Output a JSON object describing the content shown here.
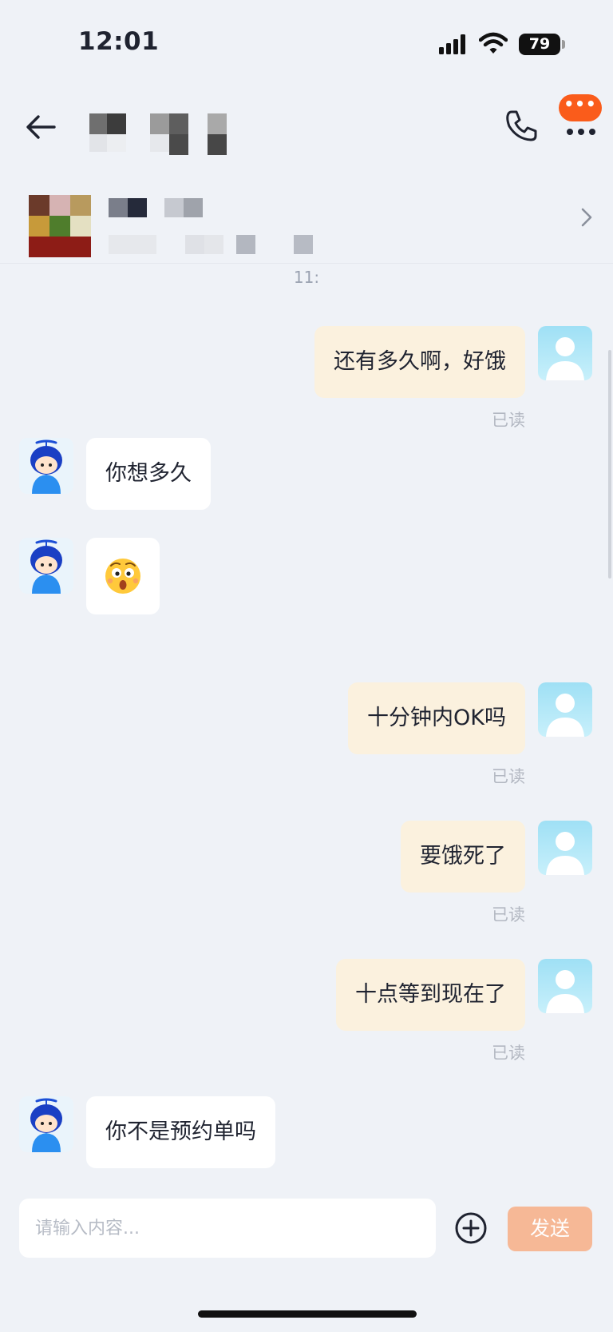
{
  "status_bar": {
    "time": "12:01",
    "battery_level": "79"
  },
  "header": {
    "back_icon": "arrow-left-icon",
    "phone_icon": "phone-icon",
    "more_icon": "more-dots-icon",
    "more_badge": "•••"
  },
  "order_card": {
    "chevron_icon": "chevron-right-icon"
  },
  "time_divider": "11:",
  "messages": [
    {
      "side": "out",
      "text": "还有多久啊，好饿",
      "read": "已读"
    },
    {
      "side": "in",
      "text": "你想多久"
    },
    {
      "side": "in",
      "type": "emoji",
      "emoji": "surprised-face-emoji"
    },
    {
      "side": "out",
      "text": "十分钟内OK吗",
      "read": "已读"
    },
    {
      "side": "out",
      "text": "要饿死了",
      "read": "已读"
    },
    {
      "side": "out",
      "text": "十点等到现在了",
      "read": "已读"
    },
    {
      "side": "in",
      "text": "你不是预约单吗"
    }
  ],
  "input": {
    "placeholder": "请输入内容...",
    "value": ""
  },
  "actions": {
    "plus_icon": "plus-circle-icon",
    "send_label": "发送"
  },
  "colors": {
    "background": "#eff2f7",
    "outgoing_bubble": "#fbf1de",
    "incoming_bubble": "#ffffff",
    "send_button": "#f6b896",
    "badge": "#fa5c1b"
  }
}
